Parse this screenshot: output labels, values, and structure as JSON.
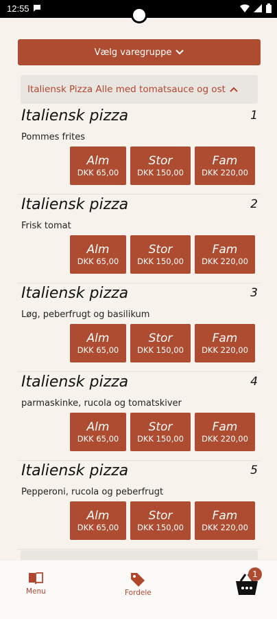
{
  "status_bar": {
    "time": "12:55"
  },
  "group_selector": {
    "label": "Vælg varegruppe"
  },
  "category": {
    "label": "Italiensk Pizza Alle med tomatsauce og ost"
  },
  "items": [
    {
      "title": "Italiensk pizza",
      "number": "1",
      "desc": "Pommes frites",
      "sizes": [
        {
          "name": "Alm",
          "price": "DKK 65,00"
        },
        {
          "name": "Stor",
          "price": "DKK 150,00"
        },
        {
          "name": "Fam",
          "price": "DKK 220,00"
        }
      ]
    },
    {
      "title": "Italiensk pizza",
      "number": "2",
      "desc": "Frisk tomat",
      "sizes": [
        {
          "name": "Alm",
          "price": "DKK 65,00"
        },
        {
          "name": "Stor",
          "price": "DKK 150,00"
        },
        {
          "name": "Fam",
          "price": "DKK 220,00"
        }
      ]
    },
    {
      "title": "Italiensk pizza",
      "number": "3",
      "desc": "Løg, peberfrugt og basilikum",
      "sizes": [
        {
          "name": "Alm",
          "price": "DKK 65,00"
        },
        {
          "name": "Stor",
          "price": "DKK 150,00"
        },
        {
          "name": "Fam",
          "price": "DKK 220,00"
        }
      ]
    },
    {
      "title": "Italiensk pizza",
      "number": "4",
      "desc": "parmaskinke, rucola og tomatskiver",
      "sizes": [
        {
          "name": "Alm",
          "price": "DKK 65,00"
        },
        {
          "name": "Stor",
          "price": "DKK 150,00"
        },
        {
          "name": "Fam",
          "price": "DKK 220,00"
        }
      ]
    },
    {
      "title": "Italiensk pizza",
      "number": "5",
      "desc": "Pepperoni, rucola og peberfrugt",
      "sizes": [
        {
          "name": "Alm",
          "price": "DKK 65,00"
        },
        {
          "name": "Stor",
          "price": "DKK 150,00"
        },
        {
          "name": "Fam",
          "price": "DKK 220,00"
        }
      ]
    }
  ],
  "nav": {
    "menu_label": "Menu",
    "fordele_label": "Fordele",
    "cart_count": "1"
  },
  "colors": {
    "accent": "#ad4c30",
    "background": "#f7f3ec"
  },
  "icons": {
    "menu": "book-icon",
    "fordele": "tag-icon",
    "cart": "basket-icon"
  }
}
